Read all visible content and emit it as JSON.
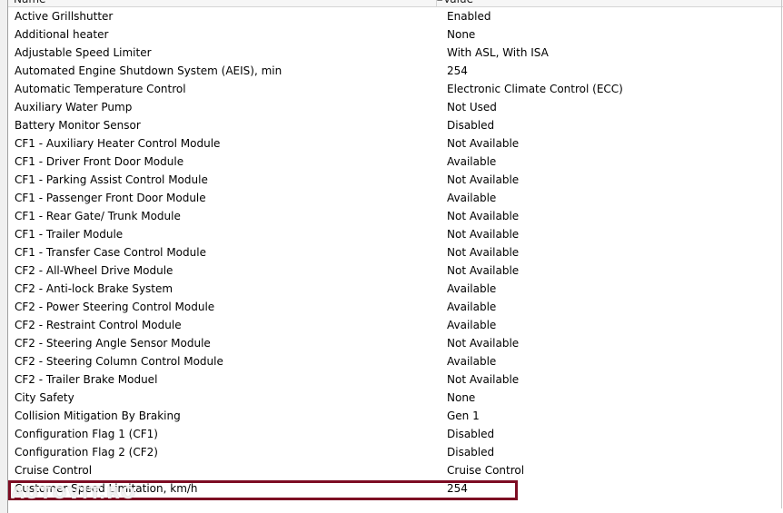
{
  "table": {
    "columns": [
      "Name",
      "Value"
    ],
    "rows": [
      {
        "name": "Active Grillshutter",
        "value": "Enabled"
      },
      {
        "name": "Additional heater",
        "value": "None"
      },
      {
        "name": "Adjustable Speed Limiter",
        "value": "With ASL, With ISA"
      },
      {
        "name": "Automated Engine Shutdown System (AEIS), min",
        "value": "254"
      },
      {
        "name": "Automatic Temperature Control",
        "value": "Electronic Climate Control (ECC)"
      },
      {
        "name": "Auxiliary Water Pump",
        "value": "Not Used"
      },
      {
        "name": "Battery Monitor Sensor",
        "value": "Disabled"
      },
      {
        "name": "CF1 - Auxiliary Heater Control Module",
        "value": "Not Available"
      },
      {
        "name": "CF1 - Driver Front Door Module",
        "value": "Available"
      },
      {
        "name": "CF1 - Parking Assist Control Module",
        "value": "Not Available"
      },
      {
        "name": "CF1 - Passenger Front Door Module",
        "value": "Available"
      },
      {
        "name": "CF1 - Rear Gate/ Trunk Module",
        "value": "Not Available"
      },
      {
        "name": "CF1 - Trailer Module",
        "value": "Not Available"
      },
      {
        "name": "CF1 - Transfer Case Control Module",
        "value": "Not Available"
      },
      {
        "name": "CF2 - All-Wheel Drive Module",
        "value": "Not Available"
      },
      {
        "name": "CF2 - Anti-lock Brake System",
        "value": "Available"
      },
      {
        "name": "CF2 - Power Steering Control Module",
        "value": "Available"
      },
      {
        "name": "CF2 - Restraint Control Module",
        "value": "Available"
      },
      {
        "name": "CF2 - Steering Angle Sensor Module",
        "value": "Not Available"
      },
      {
        "name": "CF2 - Steering Column Control Module",
        "value": "Available"
      },
      {
        "name": "CF2 - Trailer Brake Moduel",
        "value": "Not Available"
      },
      {
        "name": "City Safety",
        "value": "None"
      },
      {
        "name": "Collision Mitigation By Braking",
        "value": "Gen 1"
      },
      {
        "name": "Configuration Flag 1 (CF1)",
        "value": "Disabled"
      },
      {
        "name": "Configuration Flag 2 (CF2)",
        "value": "Disabled"
      },
      {
        "name": "Cruise Control",
        "value": "Cruise Control"
      },
      {
        "name": "Customer Speed Limitation, km/h",
        "value": "254"
      }
    ]
  },
  "highlight": {
    "row_name": "Customer Speed Limitation, km/h",
    "color": "#7d0c23"
  },
  "watermark": {
    "text": "AUTOVIT.RO"
  }
}
